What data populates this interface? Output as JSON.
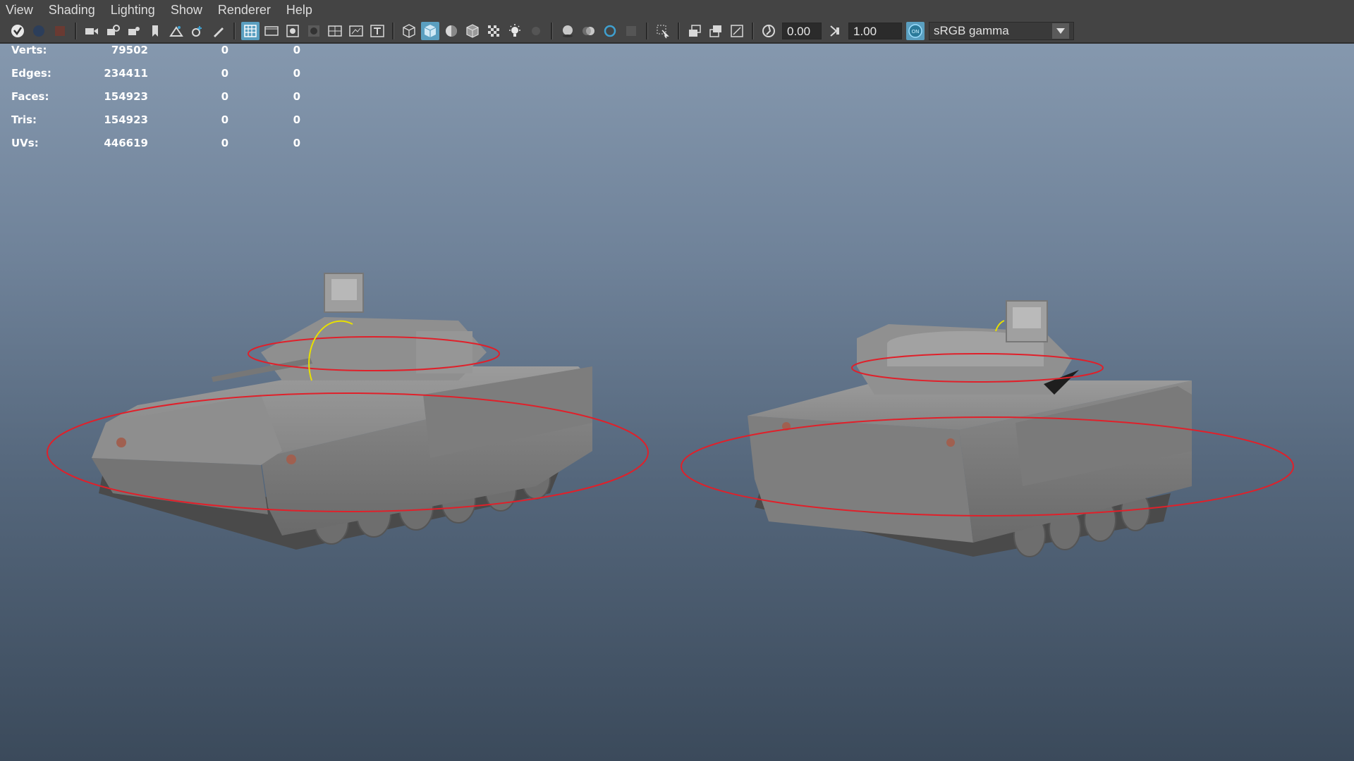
{
  "menu": [
    "View",
    "Shading",
    "Lighting",
    "Show",
    "Renderer",
    "Help"
  ],
  "toolbar": {
    "exposure_value": "0.00",
    "gamma_value": "1.00",
    "color_space": "sRGB gamma",
    "icons": [
      "select-camera-icon",
      "lock-camera-icon",
      "camera-attributes-icon",
      "bookmark-icon",
      "image-plane-icon",
      "2d-pan-zoom-icon",
      "grease-pencil-icon",
      "grid-icon",
      "film-gate-icon",
      "resolution-gate-icon",
      "gate-mask-icon",
      "field-chart-icon",
      "safe-action-icon",
      "safe-title-icon",
      "wireframe-icon",
      "smooth-shade-icon",
      "use-default-material-icon",
      "wireframe-on-shaded-icon",
      "xray-icon",
      "use-all-lights-icon",
      "shadows-icon",
      "screen-space-ao-icon",
      "motion-blur-icon",
      "anti-aliasing-icon",
      "depth-of-field-icon",
      "isolate-select-icon",
      "xray-joints-icon",
      "xray-active-components-icon",
      "backface-culling-icon",
      "exposure-icon",
      "gamma-icon",
      "color-management-icon",
      "dropdown-arrow-icon"
    ],
    "color_management_badge": "ON"
  },
  "hud": {
    "rows": [
      {
        "label": "Verts:",
        "v1": "79502",
        "v2": "0",
        "v3": "0"
      },
      {
        "label": "Edges:",
        "v1": "234411",
        "v2": "0",
        "v3": "0"
      },
      {
        "label": "Faces:",
        "v1": "154923",
        "v2": "0",
        "v3": "0"
      },
      {
        "label": "Tris:",
        "v1": "154923",
        "v2": "0",
        "v3": "0"
      },
      {
        "label": "UVs:",
        "v1": "446619",
        "v2": "0",
        "v3": "0"
      }
    ]
  },
  "colors": {
    "ui_bg": "#444444",
    "active_blue": "#5a9fc0",
    "control_curve_red": "#e0202a",
    "rotate_handle_yellow": "#e8e000",
    "model_grey": "#8a8a8a"
  }
}
